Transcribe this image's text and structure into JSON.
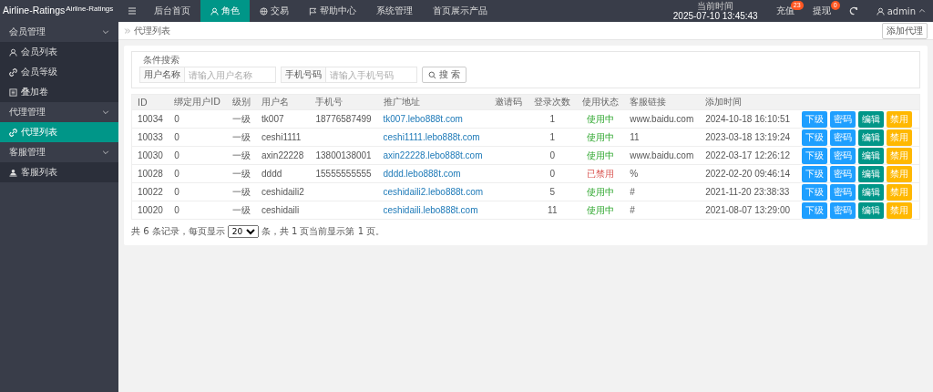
{
  "logo": {
    "title": "Airline-Ratings",
    "subtitle": "Airline-Ratings"
  },
  "nav": [
    {
      "label": "后台首页",
      "kind": "plain",
      "selected": false
    },
    {
      "label": "角色",
      "kind": "person",
      "selected": true
    },
    {
      "label": "交易",
      "kind": "globe",
      "selected": false
    },
    {
      "label": "帮助中心",
      "kind": "flag",
      "selected": false
    },
    {
      "label": "系统管理",
      "kind": "plain",
      "selected": false
    },
    {
      "label": "首页展示产品",
      "kind": "plain",
      "selected": false
    }
  ],
  "header_right": {
    "time_label": "当前时间",
    "time": "2025-07-10 13:45:43",
    "actions": [
      {
        "label": "充值",
        "badge": "23"
      },
      {
        "label": "提现",
        "badge": "0"
      }
    ],
    "user": "admin"
  },
  "sidebar": [
    {
      "label": "会员管理",
      "expanded": true,
      "children": [
        {
          "label": "会员列表",
          "kind": "person",
          "selected": false
        },
        {
          "label": "会员等级",
          "kind": "link",
          "selected": false
        },
        {
          "label": "叠加卷",
          "kind": "list",
          "selected": false
        }
      ]
    },
    {
      "label": "代理管理",
      "expanded": true,
      "children": [
        {
          "label": "代理列表",
          "kind": "link",
          "selected": true
        }
      ]
    },
    {
      "label": "客服管理",
      "expanded": true,
      "children": [
        {
          "label": "客服列表",
          "kind": "people",
          "selected": false
        }
      ]
    }
  ],
  "breadcrumb": "代理列表",
  "add_button": "添加代理",
  "search": {
    "legend": "条件搜索",
    "fields": [
      {
        "label": "用户名称",
        "placeholder": "请输入用户名称"
      },
      {
        "label": "手机号码",
        "placeholder": "请输入手机号码"
      }
    ],
    "button": "搜 索"
  },
  "table": {
    "columns": [
      "ID",
      "绑定用户ID",
      "级别",
      "用户名",
      "手机号",
      "推广地址",
      "邀请码",
      "登录次数",
      "使用状态",
      "客服链接",
      "添加时间"
    ],
    "rows": [
      {
        "id": "10034",
        "bound_id": "0",
        "level": "一级",
        "username": "tk007",
        "phone": "18776587499",
        "url": "tk007.lebo888t.com",
        "logins": "1",
        "status": {
          "text": "使用中",
          "active": true
        },
        "service_link": "www.baidu.com",
        "added": "2024-10-18 16:10:51",
        "actions": [
          {
            "label": "下级",
            "kind": "sub"
          },
          {
            "label": "密码",
            "kind": "password"
          },
          {
            "label": "编辑",
            "kind": "edit"
          },
          {
            "label": "禁用",
            "kind": "disable"
          }
        ]
      },
      {
        "id": "10033",
        "bound_id": "0",
        "level": "一级",
        "username": "ceshi1111",
        "url": "ceshi1111.lebo888t.com",
        "logins": "1",
        "status": {
          "text": "使用中",
          "active": true
        },
        "service_link": "11",
        "added": "2023-03-18 13:19:24",
        "actions": [
          {
            "label": "下级",
            "kind": "sub"
          },
          {
            "label": "密码",
            "kind": "password"
          },
          {
            "label": "编辑",
            "kind": "edit"
          },
          {
            "label": "禁用",
            "kind": "disable"
          }
        ]
      },
      {
        "id": "10030",
        "bound_id": "0",
        "level": "一级",
        "username": "axin22228",
        "phone": "13800138001",
        "url": "axin22228.lebo888t.com",
        "logins": "0",
        "status": {
          "text": "使用中",
          "active": true
        },
        "service_link": "www.baidu.com",
        "added": "2022-03-17 12:26:12",
        "actions": [
          {
            "label": "下级",
            "kind": "sub"
          },
          {
            "label": "密码",
            "kind": "password"
          },
          {
            "label": "编辑",
            "kind": "edit"
          },
          {
            "label": "禁用",
            "kind": "disable"
          }
        ]
      },
      {
        "id": "10028",
        "bound_id": "0",
        "level": "一级",
        "username": "dddd",
        "phone": "15555555555",
        "url": "dddd.lebo888t.com",
        "logins": "0",
        "status": {
          "text": "已禁用",
          "active": false
        },
        "service_link": "%",
        "added": "2022-02-20 09:46:14",
        "actions": [
          {
            "label": "下级",
            "kind": "sub"
          },
          {
            "label": "密码",
            "kind": "password"
          },
          {
            "label": "编辑",
            "kind": "edit"
          },
          {
            "label": "禁用",
            "kind": "disable"
          }
        ]
      },
      {
        "id": "10022",
        "bound_id": "0",
        "level": "一级",
        "username": "ceshidaili2",
        "url": "ceshidaili2.lebo888t.com",
        "logins": "5",
        "status": {
          "text": "使用中",
          "active": true
        },
        "service_link": "#",
        "added": "2021-11-20 23:38:33",
        "actions": [
          {
            "label": "下级",
            "kind": "sub"
          },
          {
            "label": "密码",
            "kind": "password"
          },
          {
            "label": "编辑",
            "kind": "edit"
          },
          {
            "label": "禁用",
            "kind": "disable"
          }
        ]
      },
      {
        "id": "10020",
        "bound_id": "0",
        "level": "一级",
        "username": "ceshidaili",
        "url": "ceshidaili.lebo888t.com",
        "logins": "11",
        "status": {
          "text": "使用中",
          "active": true
        },
        "service_link": "#",
        "added": "2021-08-07 13:29:00",
        "actions": [
          {
            "label": "下级",
            "kind": "sub"
          },
          {
            "label": "密码",
            "kind": "password"
          },
          {
            "label": "编辑",
            "kind": "edit"
          },
          {
            "label": "禁用",
            "kind": "disable"
          }
        ]
      }
    ]
  },
  "pagination": {
    "before": "共 6 条记录，每页显示",
    "page_size": "20",
    "after": "条，共 1 页当前显示第 1 页。"
  }
}
